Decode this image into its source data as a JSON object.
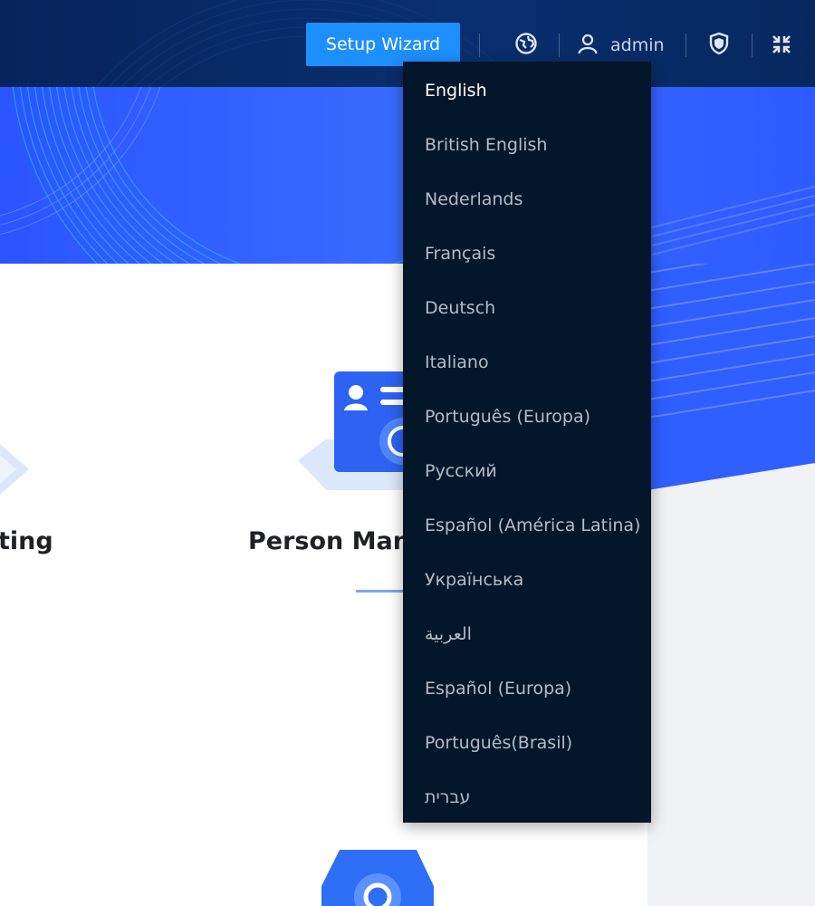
{
  "header": {
    "setup_wizard_label": "Setup Wizard",
    "username": "admin",
    "icons": [
      "language-icon",
      "user-icon",
      "shield-icon",
      "collapse-icon"
    ]
  },
  "cards": {
    "left_title_fragment": "ting",
    "center_title": "Person Mana"
  },
  "language_menu": {
    "selected": "English",
    "items": [
      "English",
      "British English",
      "Nederlands",
      "Français",
      "Deutsch",
      "Italiano",
      "Português (Europa)",
      "Русский",
      "Español (América Latina)",
      "Українська",
      "العربية",
      "Español (Europa)",
      "Português(Brasil)",
      "עברית"
    ]
  },
  "colors": {
    "header_bg": "#06245c",
    "hero_blue": "#2b5cff",
    "accent_button": "#1e8fff",
    "menu_bg": "#041629",
    "menu_text": "#b4bcc8",
    "menu_text_selected": "#ffffff"
  }
}
